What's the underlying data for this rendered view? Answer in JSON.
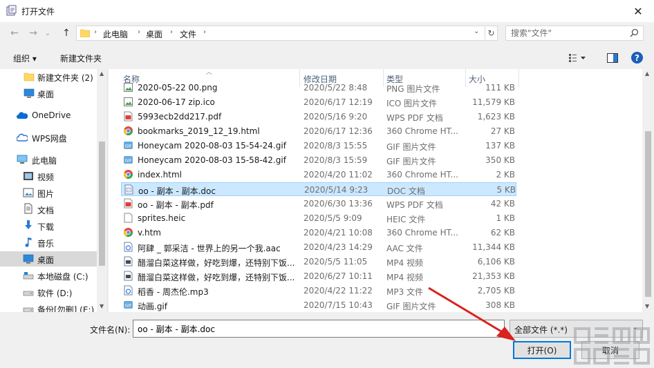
{
  "window": {
    "title": "打开文件",
    "close_label": "✕"
  },
  "nav": {
    "back": "←",
    "forward": "→",
    "recent": "⌄",
    "up": "↑",
    "breadcrumbs": [
      "此电脑",
      "桌面",
      "文件"
    ],
    "refresh": "↻"
  },
  "search": {
    "placeholder": "搜索\"文件\""
  },
  "toolbar": {
    "organize": "组织 ▾",
    "new_folder": "新建文件夹",
    "help": "?"
  },
  "sidebar": {
    "items": [
      {
        "label": "新建文件夹 (2)",
        "icon": "folder-yellow"
      },
      {
        "label": "桌面",
        "icon": "desktop"
      },
      {
        "label": "OneDrive",
        "icon": "cloud"
      },
      {
        "label": "WPS网盘",
        "icon": "cloud"
      },
      {
        "label": "此电脑",
        "icon": "computer"
      },
      {
        "label": "视频",
        "icon": "video"
      },
      {
        "label": "图片",
        "icon": "picture"
      },
      {
        "label": "文档",
        "icon": "document"
      },
      {
        "label": "下载",
        "icon": "download"
      },
      {
        "label": "音乐",
        "icon": "music"
      },
      {
        "label": "桌面",
        "icon": "desktop"
      },
      {
        "label": "本地磁盘 (C:)",
        "icon": "drive"
      },
      {
        "label": "软件 (D:)",
        "icon": "drive"
      },
      {
        "label": "备份[勿删] (E:)",
        "icon": "drive"
      }
    ]
  },
  "columns": {
    "name": "名称",
    "date": "修改日期",
    "type": "类型",
    "size": "大小"
  },
  "files": [
    {
      "name": "2020-05-22 00.png",
      "date": "2020/5/22 8:48",
      "type": "PNG 图片文件",
      "size": "111 KB",
      "icon": "image"
    },
    {
      "name": "2020-06-17 zip.ico",
      "date": "2020/6/17 12:19",
      "type": "ICO 图片文件",
      "size": "11,579 KB",
      "icon": "image"
    },
    {
      "name": "5993ecb2dd217.pdf",
      "date": "2020/5/16 9:20",
      "type": "WPS PDF 文档",
      "size": "1,623 KB",
      "icon": "pdf"
    },
    {
      "name": "bookmarks_2019_12_19.html",
      "date": "2020/6/17 12:36",
      "type": "360 Chrome HT...",
      "size": "27 KB",
      "icon": "chrome"
    },
    {
      "name": "Honeycam 2020-08-03 15-54-24.gif",
      "date": "2020/8/3 15:55",
      "type": "GIF 图片文件",
      "size": "137 KB",
      "icon": "gif"
    },
    {
      "name": "Honeycam 2020-08-03 15-58-42.gif",
      "date": "2020/8/3 15:59",
      "type": "GIF 图片文件",
      "size": "350 KB",
      "icon": "gif"
    },
    {
      "name": "index.html",
      "date": "2020/4/20 11:02",
      "type": "360 Chrome HT...",
      "size": "2 KB",
      "icon": "chrome"
    },
    {
      "name": "oo - 副本 - 副本.doc",
      "date": "2020/5/14 9:23",
      "type": "DOC 文档",
      "size": "5 KB",
      "icon": "doc"
    },
    {
      "name": "oo - 副本 - 副本.pdf",
      "date": "2020/6/30 13:36",
      "type": "WPS PDF 文档",
      "size": "42 KB",
      "icon": "pdf"
    },
    {
      "name": "sprites.heic",
      "date": "2020/5/5 9:09",
      "type": "HEIC 文件",
      "size": "1 KB",
      "icon": "blank"
    },
    {
      "name": "v.htm",
      "date": "2020/4/21 10:08",
      "type": "360 Chrome HT...",
      "size": "62 KB",
      "icon": "chrome"
    },
    {
      "name": "阿肆 _ 郭采洁 - 世界上的另一个我.aac",
      "date": "2020/4/23 14:29",
      "type": "AAC 文件",
      "size": "11,344 KB",
      "icon": "audio"
    },
    {
      "name": "醋溜白菜这样做，好吃到爆，还特别下饭...",
      "date": "2020/5/5 11:05",
      "type": "MP4 视频",
      "size": "6,106 KB",
      "icon": "video"
    },
    {
      "name": "醋溜白菜这样做，好吃到爆，还特别下饭...",
      "date": "2020/6/27 10:11",
      "type": "MP4 视频",
      "size": "21,353 KB",
      "icon": "video"
    },
    {
      "name": "稻香 - 周杰伦.mp3",
      "date": "2020/4/22 11:22",
      "type": "MP3 文件",
      "size": "2,705 KB",
      "icon": "audio"
    },
    {
      "name": "动画.gif",
      "date": "2020/7/15 10:43",
      "type": "GIF 图片文件",
      "size": "308 KB",
      "icon": "gif"
    }
  ],
  "selected_file_index": 7,
  "footer": {
    "filename_label": "文件名(N):",
    "filename_value": "oo - 副本 - 副本.doc",
    "filetype": "全部文件 (*.*)",
    "open_button": "打开(O)",
    "cancel_button": "取消"
  },
  "colors": {
    "selection": "#cce8ff",
    "accent": "#0078d7",
    "folder": "#ffd767"
  }
}
